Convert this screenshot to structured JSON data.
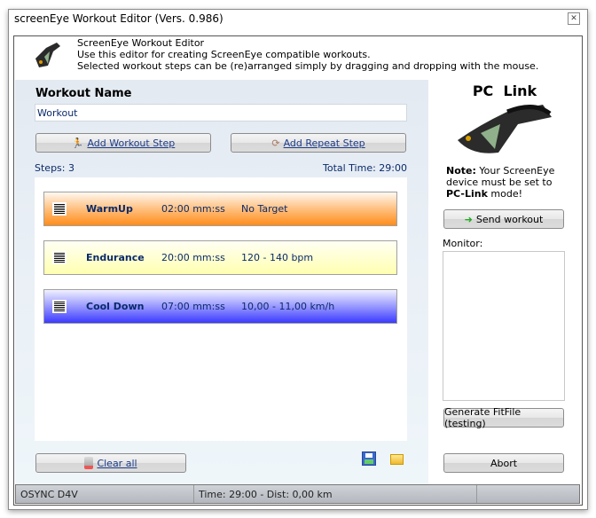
{
  "window": {
    "title": "screenEye Workout Editor (Vers. 0.986)"
  },
  "header": {
    "title": "ScreenEye Workout Editor",
    "line1": "Use this editor for creating ScreenEye compatible workouts.",
    "line2": "Selected workout steps can be (re)arranged simply by dragging and dropping with the mouse."
  },
  "workout": {
    "name_label": "Workout Name",
    "name_value": "Workout",
    "add_step": "Add Workout Step",
    "add_repeat": "Add Repeat Step",
    "steps": "Steps: 3",
    "total_time": "Total Time: 29:00",
    "clear_all": "Clear all"
  },
  "steps": [
    {
      "name": "WarmUp",
      "duration": "02:00 mm:ss",
      "target": "No Target",
      "color": "#ff8c1a"
    },
    {
      "name": "Endurance",
      "duration": "20:00 mm:ss",
      "target": "120 - 140 bpm",
      "color": "#ffffb0"
    },
    {
      "name": "Cool Down",
      "duration": "07:00 mm:ss",
      "target": "10,00 - 11,00 km/h",
      "color": "#3a3aff"
    }
  ],
  "pclink": {
    "title": "PC  Link",
    "note_bold": "Note:",
    "note_text": " Your ScreenEye device must be set to ",
    "note_mode": "PC-Link",
    "note_end": " mode!",
    "send": "Send workout",
    "monitor_label": "Monitor:",
    "generate": "Generate FitFile (testing)",
    "abort": "Abort"
  },
  "status": {
    "device": "OSYNC D4V",
    "summary": "Time: 29:00 - Dist: 0,00 km",
    "extra": ""
  }
}
